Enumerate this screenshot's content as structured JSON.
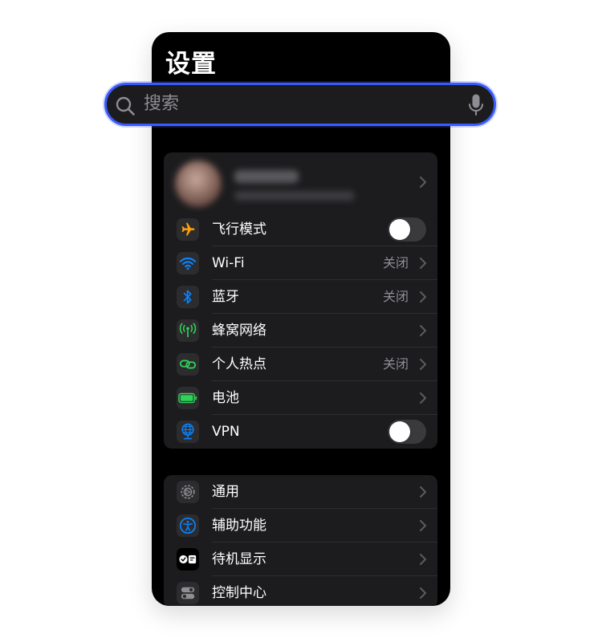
{
  "header": {
    "title": "设置"
  },
  "search": {
    "placeholder": "搜索"
  },
  "profile": {
    "name": "",
    "subtitle": ""
  },
  "connectivity": [
    {
      "label": "飞行模式",
      "value": "",
      "control": "toggle",
      "on": false,
      "icon": "airplane-icon",
      "icon_bg": "#2c2c2e",
      "icon_color": "#ff9f0a"
    },
    {
      "label": "Wi-Fi",
      "value": "关闭",
      "control": "chevron",
      "icon": "wifi-icon",
      "icon_bg": "#2c2c2e",
      "icon_color": "#0a84ff"
    },
    {
      "label": "蓝牙",
      "value": "关闭",
      "control": "chevron",
      "icon": "bluetooth-icon",
      "icon_bg": "#2c2c2e",
      "icon_color": "#0a84ff"
    },
    {
      "label": "蜂窝网络",
      "value": "",
      "control": "chevron",
      "icon": "cellular-icon",
      "icon_bg": "#2c2c2e",
      "icon_color": "#30d158"
    },
    {
      "label": "个人热点",
      "value": "关闭",
      "control": "chevron",
      "icon": "hotspot-icon",
      "icon_bg": "#2c2c2e",
      "icon_color": "#30d158"
    },
    {
      "label": "电池",
      "value": "",
      "control": "chevron",
      "icon": "battery-icon",
      "icon_bg": "#2c2c2e",
      "icon_color": "#30d158"
    },
    {
      "label": "VPN",
      "value": "",
      "control": "toggle",
      "on": false,
      "icon": "vpn-globe-icon",
      "icon_bg": "#2c2c2e",
      "icon_color": "#0a84ff"
    }
  ],
  "general": [
    {
      "label": "通用",
      "icon": "gear-icon",
      "icon_bg": "#2c2c2e",
      "icon_color": "#8e8e93"
    },
    {
      "label": "辅助功能",
      "icon": "accessibility-icon",
      "icon_bg": "#2c2c2e",
      "icon_color": "#0a84ff"
    },
    {
      "label": "待机显示",
      "icon": "standby-icon",
      "icon_bg": "#2c2c2e",
      "icon_color": "#ffffff"
    },
    {
      "label": "控制中心",
      "icon": "control-center-icon",
      "icon_bg": "#2c2c2e",
      "icon_color": "#8e8e93"
    }
  ],
  "colors": {
    "accent": "#3b5bfa",
    "background": "#000000",
    "cell": "#1c1c1e",
    "secondary_text": "#8d8d93"
  }
}
